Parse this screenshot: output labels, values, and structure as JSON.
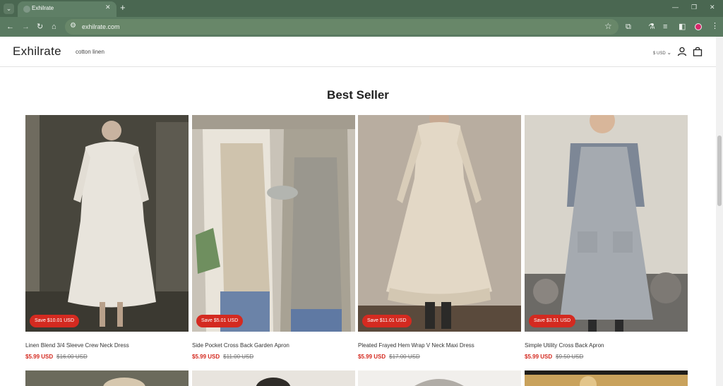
{
  "browser": {
    "tab_title": "Exhilrate",
    "url": "exhilrate.com"
  },
  "store": {
    "logo": "Exhilrate",
    "nav_link": "cotton linen",
    "currency": "$ USD"
  },
  "section": {
    "title": "Best Seller"
  },
  "products": [
    {
      "title": "Linen Blend 3/4 Sleeve Crew Neck Dress",
      "badge": "Save $10.01 USD",
      "price": "$5.99 USD",
      "compare_price": "$16.00 USD"
    },
    {
      "title": "Side Pocket Cross Back Garden Apron",
      "badge": "Save $5.01 USD",
      "price": "$5.99 USD",
      "compare_price": "$11.00 USD"
    },
    {
      "title": "Pleated Frayed Hem Wrap V Neck Maxi Dress",
      "badge": "Save $11.01 USD",
      "price": "$5.99 USD",
      "compare_price": "$17.00 USD"
    },
    {
      "title": "Simple Utility Cross Back Apron",
      "badge": "Save $3.51 USD",
      "price": "$5.99 USD",
      "compare_price": "$9.50 USD"
    }
  ],
  "colors": {
    "chrome_dark": "#4a6751",
    "chrome": "#5a7a61",
    "sale_badge": "#d42a20",
    "sale_price": "#d42a20"
  },
  "icons": {
    "tab_menu": "chevron-down-icon",
    "new_tab": "plus-icon",
    "back": "arrow-left-icon",
    "forward": "arrow-right-icon",
    "reload": "reload-icon",
    "home": "home-icon",
    "bookmark": "star-icon",
    "account": "user-icon",
    "cart": "bag-icon"
  }
}
